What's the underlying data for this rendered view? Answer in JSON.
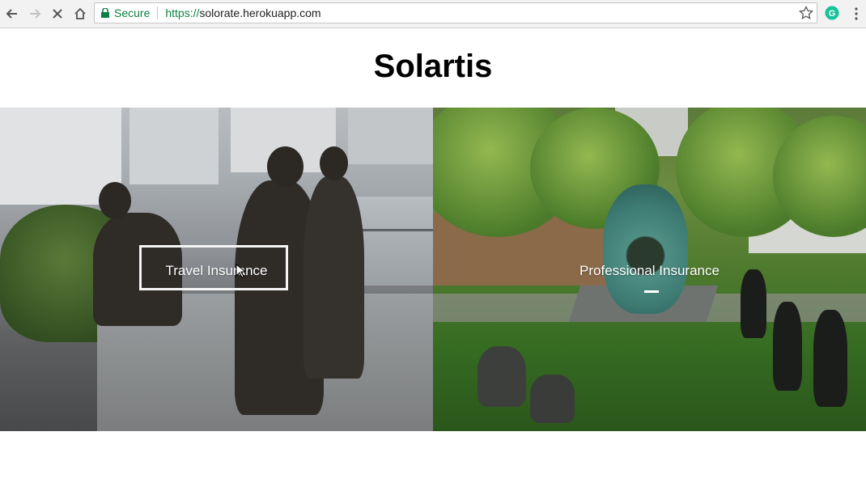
{
  "browser": {
    "secure_label": "Secure",
    "url_scheme": "https://",
    "url_host": "solorate.herokuapp.com",
    "icons": {
      "back": "back-arrow-icon",
      "forward": "forward-arrow-icon",
      "stop": "close-icon",
      "home": "home-icon",
      "lock": "lock-icon",
      "star": "star-icon",
      "extension": "grammarly-icon",
      "menu": "kebab-menu-icon"
    },
    "colors": {
      "secure": "#0b8043",
      "extension": "#15c39a"
    }
  },
  "page": {
    "title": "Solartis",
    "panels": [
      {
        "label": "Travel Insurance"
      },
      {
        "label": "Professional Insurance"
      }
    ]
  }
}
